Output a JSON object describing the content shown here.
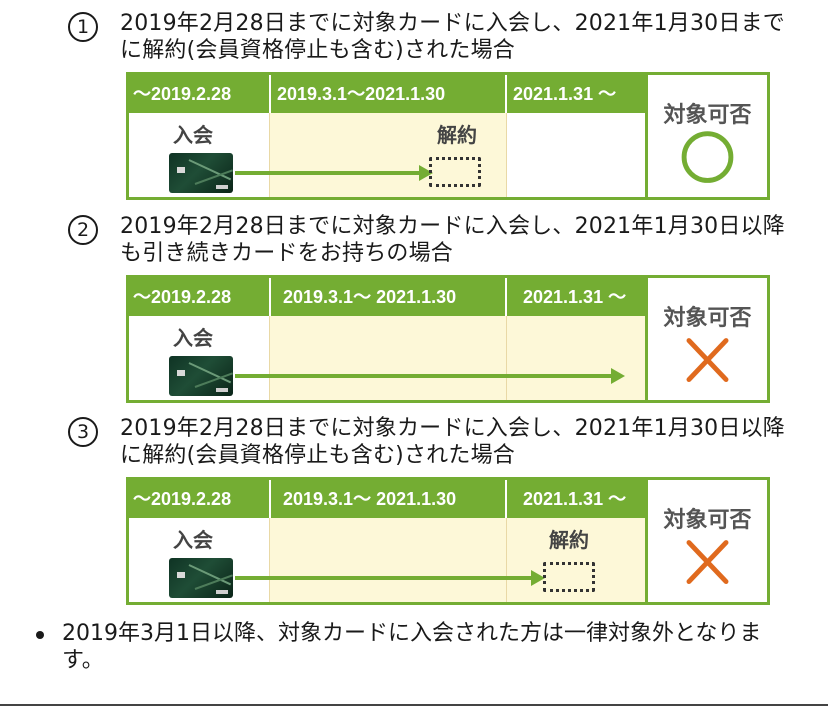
{
  "cases": [
    {
      "number": "1",
      "text": "2019年2月28日までに対象カードに入会し、2021年1月30日までに解約(会員資格停止も含む)された場合",
      "headers": [
        "〜2019.2.28",
        "2019.3.1〜2021.1.30",
        "2021.1.31 〜"
      ],
      "join_label": "入会",
      "cancel_label": "解約",
      "verdict_label": "対象可否",
      "verdict": "circle"
    },
    {
      "number": "2",
      "text": "2019年2月28日までに対象カードに入会し、2021年1月30日以降も引き続きカードをお持ちの場合",
      "headers": [
        "〜2019.2.28",
        "2019.3.1〜 2021.1.30",
        "2021.1.31 〜"
      ],
      "join_label": "入会",
      "cancel_label": "",
      "verdict_label": "対象可否",
      "verdict": "cross"
    },
    {
      "number": "3",
      "text": "2019年2月28日までに対象カードに入会し、2021年1月30日以降に解約(会員資格停止も含む)された場合",
      "headers": [
        "〜2019.2.28",
        "2019.3.1〜 2021.1.30",
        "2021.1.31 〜"
      ],
      "join_label": "入会",
      "cancel_label": "解約",
      "verdict_label": "対象可否",
      "verdict": "cross"
    }
  ],
  "note": "2019年3月1日以降、対象カードに入会された方は一律対象外となります。",
  "colors": {
    "green": "#74ad33",
    "beige": "#fdf8d8",
    "cross": "#e06a1e"
  }
}
